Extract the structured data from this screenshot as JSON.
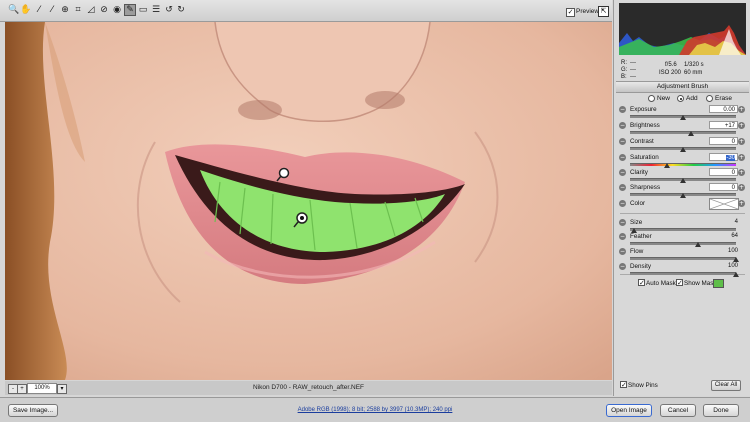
{
  "toolbar": {
    "tools": [
      {
        "icon": "zoom-icon",
        "glyph": "🔍"
      },
      {
        "icon": "hand-icon",
        "glyph": "✋"
      },
      {
        "icon": "white-balance-icon",
        "glyph": "⁄"
      },
      {
        "icon": "color-sampler-icon",
        "glyph": "⁄"
      },
      {
        "icon": "targeted-adjustment-icon",
        "glyph": "⊕"
      },
      {
        "icon": "crop-icon",
        "glyph": "⌗"
      },
      {
        "icon": "straighten-icon",
        "glyph": "◿"
      },
      {
        "icon": "spot-removal-icon",
        "glyph": "⊘"
      },
      {
        "icon": "red-eye-icon",
        "glyph": "◉"
      },
      {
        "icon": "adjustment-brush-icon",
        "glyph": "✎"
      },
      {
        "icon": "graduated-filter-icon",
        "glyph": "▭"
      },
      {
        "icon": "preferences-icon",
        "glyph": "☰"
      },
      {
        "icon": "rotate-left-icon",
        "glyph": "↺"
      },
      {
        "icon": "rotate-right-icon",
        "glyph": "↻"
      }
    ],
    "preview_label": "Preview",
    "preview_checked": "✓"
  },
  "photo_status": {
    "zoom": "100%",
    "zoom_minus": "-",
    "zoom_plus": "+",
    "zoom_dropdown": "▾",
    "filename": "Nikon D700  -  RAW_retouch_after.NEF"
  },
  "info": {
    "r_label": "R:",
    "r_value": "---",
    "g_label": "G:",
    "g_value": "---",
    "b_label": "B:",
    "b_value": "---",
    "aperture": "f/5.6",
    "shutter": "1/320 s",
    "iso": "ISO 200",
    "focal": "60 mm"
  },
  "panel": {
    "title": "Adjustment Brush",
    "modes": [
      {
        "label": "New",
        "selected": false
      },
      {
        "label": "Add",
        "selected": true
      },
      {
        "label": "Erase",
        "selected": false
      }
    ],
    "sliders": [
      {
        "label": "Exposure",
        "value": "0.00",
        "position": 0.5
      },
      {
        "label": "Brightness",
        "value": "+17",
        "position": 0.58
      },
      {
        "label": "Contrast",
        "value": "0",
        "position": 0.5
      },
      {
        "label": "Saturation",
        "value": "-30",
        "position": 0.35
      },
      {
        "label": "Clarity",
        "value": "0",
        "position": 0.5
      },
      {
        "label": "Sharpness",
        "value": "0",
        "position": 0.5
      }
    ],
    "color_label": "Color",
    "brush": [
      {
        "label": "Size",
        "value": "4",
        "position": 0.04
      },
      {
        "label": "Feather",
        "value": "64",
        "position": 0.64
      },
      {
        "label": "Flow",
        "value": "100",
        "position": 1.0
      },
      {
        "label": "Density",
        "value": "100",
        "position": 1.0
      }
    ],
    "auto_mask_label": "Auto Mask",
    "auto_mask_checked": "✓",
    "show_mask_label": "Show Mask",
    "show_mask_checked": "✓",
    "mask_color": "#5fbf4a",
    "show_pins_label": "Show Pins",
    "show_pins_checked": "✓",
    "clear_all": "Clear All"
  },
  "bottom": {
    "save_image": "Save Image...",
    "workflow": "Adobe RGB (1998); 8 bit; 2588 by 3997 (10.3MP); 240 ppi",
    "open_image": "Open Image",
    "cancel": "Cancel",
    "done": "Done"
  },
  "colors": {
    "skin": "#e9c1aa",
    "lips": "#e08a8e",
    "teeth_mask": "#8fe36e",
    "hair": "#b8743e",
    "accent_blue": "#3366cc"
  }
}
